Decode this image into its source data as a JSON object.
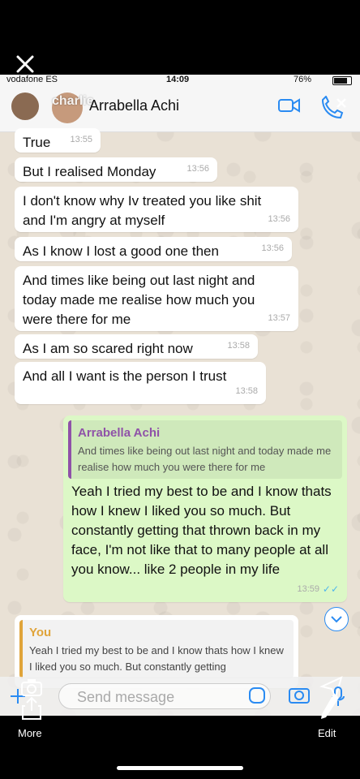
{
  "status_bar": {
    "carrier": "vodafone ES",
    "time": "14:09",
    "battery": "76%"
  },
  "header": {
    "handle": "charlie",
    "contact": "Arrabella  Achi"
  },
  "messages": [
    {
      "text": "True",
      "time": "13:55"
    },
    {
      "text": "But I realised Monday",
      "time": "13:56"
    },
    {
      "text": "I don't know why Iv treated you like shit and I'm angry at myself",
      "time": "13:56"
    },
    {
      "text": "As I know I lost a good one then",
      "time": "13:56"
    },
    {
      "text": "And times like being out last night and today made me realise how much you were there for me",
      "time": "13:57"
    },
    {
      "text": "As I am so scared right now",
      "time": "13:58"
    },
    {
      "text": "And all I want is the person I trust",
      "time": "13:58"
    }
  ],
  "reply": {
    "quote_name": "Arrabella  Achi",
    "quote_text": "And times like being out last night and today made me realise how much you were there for me",
    "text": "Yeah I tried my best to be and I know thats how I knew I liked you so much. But constantly getting that thrown back in my face, I'm not like that to many people at all you know... like 2 people in my life",
    "time": "13:59",
    "ticks": "✓✓"
  },
  "incoming_quote": {
    "name": "You",
    "text": "Yeah I tried my best to be and I know thats how I knew I liked you so much. But constantly getting"
  },
  "composer": {
    "placeholder": "Send message"
  },
  "story": {
    "more": "More",
    "edit": "Edit"
  },
  "colors": {
    "outgoing": "#dcf8c6",
    "quote_accent": "#8f52a8",
    "you_accent": "#e0a43a",
    "tick": "#4fb6ec"
  },
  "icons": [
    "close-icon",
    "video-icon",
    "call-icon",
    "camera-icon",
    "sticker-icon",
    "scroll-down-icon",
    "share-icon",
    "pen-icon",
    "add-icon"
  ]
}
